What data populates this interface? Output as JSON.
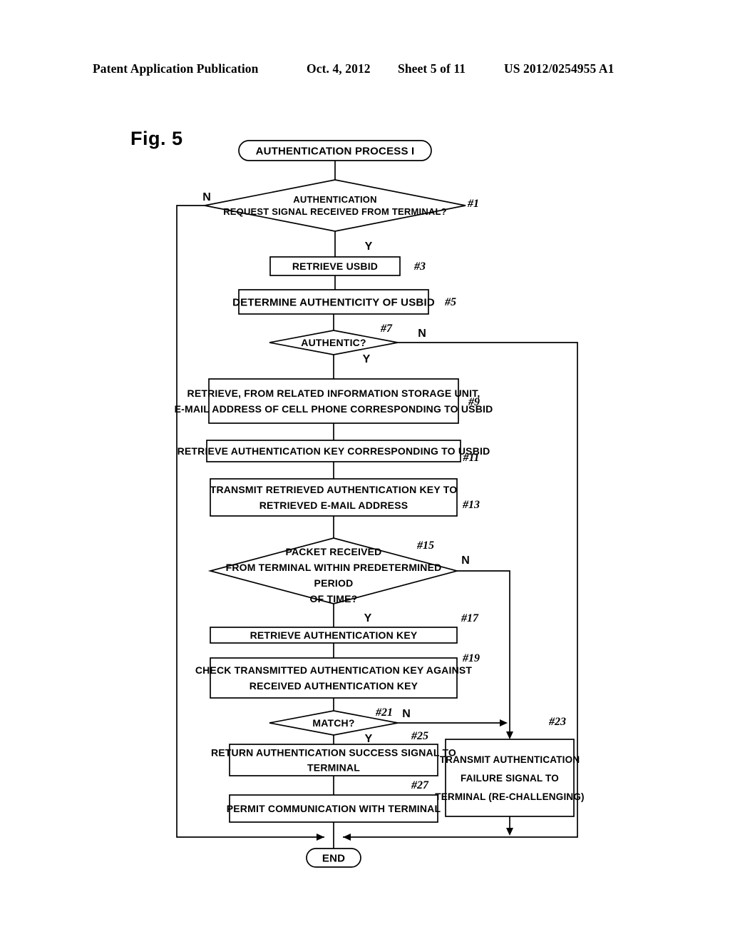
{
  "header": {
    "publication": "Patent Application Publication",
    "date": "Oct. 4, 2012",
    "sheet": "Sheet 5 of 11",
    "number": "US 2012/0254955 A1"
  },
  "figure": {
    "label": "Fig. 5"
  },
  "chart_data": {
    "type": "diagram",
    "title": "Fig. 5",
    "diagram_kind": "flowchart",
    "nodes": [
      {
        "id": "start",
        "shape": "terminator",
        "lines": [
          "AUTHENTICATION PROCESS I"
        ],
        "ref": ""
      },
      {
        "id": "d1",
        "shape": "decision",
        "lines": [
          "AUTHENTICATION",
          "REQUEST SIGNAL RECEIVED FROM TERMINAL?"
        ],
        "ref": "#1"
      },
      {
        "id": "p3",
        "shape": "process",
        "lines": [
          "RETRIEVE USBID"
        ],
        "ref": "#3"
      },
      {
        "id": "p5",
        "shape": "process",
        "lines": [
          "DETERMINE AUTHENTICITY OF USBID"
        ],
        "ref": "#5"
      },
      {
        "id": "d7",
        "shape": "decision",
        "lines": [
          "AUTHENTIC?"
        ],
        "ref": "#7"
      },
      {
        "id": "p9",
        "shape": "process",
        "lines": [
          "RETRIEVE, FROM RELATED INFORMATION STORAGE UNIT,",
          "E-MAIL ADDRESS OF CELL PHONE CORRESPONDING TO USBID"
        ],
        "ref": "#9"
      },
      {
        "id": "p11",
        "shape": "process",
        "lines": [
          "RETRIEVE AUTHENTICATION KEY CORRESPONDING TO USBID"
        ],
        "ref": "#11"
      },
      {
        "id": "p13",
        "shape": "process",
        "lines": [
          "TRANSMIT RETRIEVED AUTHENTICATION KEY TO",
          "RETRIEVED E-MAIL ADDRESS"
        ],
        "ref": "#13"
      },
      {
        "id": "d15",
        "shape": "decision",
        "lines": [
          "PACKET RECEIVED",
          "FROM TERMINAL WITHIN PREDETERMINED",
          "PERIOD",
          "OF TIME?"
        ],
        "ref": "#15"
      },
      {
        "id": "p17",
        "shape": "process",
        "lines": [
          "RETRIEVE AUTHENTICATION KEY"
        ],
        "ref": "#17"
      },
      {
        "id": "p19",
        "shape": "process",
        "lines": [
          "CHECK TRANSMITTED AUTHENTICATION KEY AGAINST",
          "RECEIVED AUTHENTICATION KEY"
        ],
        "ref": "#19"
      },
      {
        "id": "d21",
        "shape": "decision",
        "lines": [
          "MATCH?"
        ],
        "ref": "#21"
      },
      {
        "id": "p23",
        "shape": "process",
        "lines": [
          "TRANSMIT AUTHENTICATION",
          "FAILURE SIGNAL TO",
          "TERMINAL (RE-CHALLENGING)"
        ],
        "ref": "#23"
      },
      {
        "id": "p25",
        "shape": "process",
        "lines": [
          "RETURN AUTHENTICATION SUCCESS SIGNAL TO",
          "TERMINAL"
        ],
        "ref": "#25"
      },
      {
        "id": "p27",
        "shape": "process",
        "lines": [
          "PERMIT COMMUNICATION WITH TERMINAL"
        ],
        "ref": "#27"
      },
      {
        "id": "end",
        "shape": "terminator",
        "lines": [
          "END"
        ],
        "ref": ""
      }
    ],
    "branch_labels": [
      {
        "id": "d1-n",
        "text": "N",
        "from": "d1",
        "branch": "no"
      },
      {
        "id": "d1-y",
        "text": "Y",
        "from": "d1",
        "branch": "yes"
      },
      {
        "id": "d7-n",
        "text": "N",
        "from": "d7",
        "branch": "no"
      },
      {
        "id": "d7-y",
        "text": "Y",
        "from": "d7",
        "branch": "yes"
      },
      {
        "id": "d15-n",
        "text": "N",
        "from": "d15",
        "branch": "no"
      },
      {
        "id": "d15-y",
        "text": "Y",
        "from": "d15",
        "branch": "yes"
      },
      {
        "id": "d21-n",
        "text": "N",
        "from": "d21",
        "branch": "no"
      },
      {
        "id": "d21-y",
        "text": "Y",
        "from": "d21",
        "branch": "yes"
      }
    ],
    "edges": [
      {
        "from": "start",
        "to": "d1",
        "label": ""
      },
      {
        "from": "d1",
        "to": "p3",
        "label": "Y"
      },
      {
        "from": "d1",
        "to": "end",
        "label": "N"
      },
      {
        "from": "p3",
        "to": "p5",
        "label": ""
      },
      {
        "from": "p5",
        "to": "d7",
        "label": ""
      },
      {
        "from": "d7",
        "to": "p9",
        "label": "Y"
      },
      {
        "from": "d7",
        "to": "end",
        "label": "N"
      },
      {
        "from": "p9",
        "to": "p11",
        "label": ""
      },
      {
        "from": "p11",
        "to": "p13",
        "label": ""
      },
      {
        "from": "p13",
        "to": "d15",
        "label": ""
      },
      {
        "from": "d15",
        "to": "p17",
        "label": "Y"
      },
      {
        "from": "d15",
        "to": "p23",
        "label": "N"
      },
      {
        "from": "p17",
        "to": "p19",
        "label": ""
      },
      {
        "from": "p19",
        "to": "d21",
        "label": ""
      },
      {
        "from": "d21",
        "to": "p25",
        "label": "Y"
      },
      {
        "from": "d21",
        "to": "p23",
        "label": "N"
      },
      {
        "from": "p25",
        "to": "p27",
        "label": ""
      },
      {
        "from": "p27",
        "to": "end",
        "label": ""
      },
      {
        "from": "p23",
        "to": "end",
        "label": ""
      }
    ]
  }
}
